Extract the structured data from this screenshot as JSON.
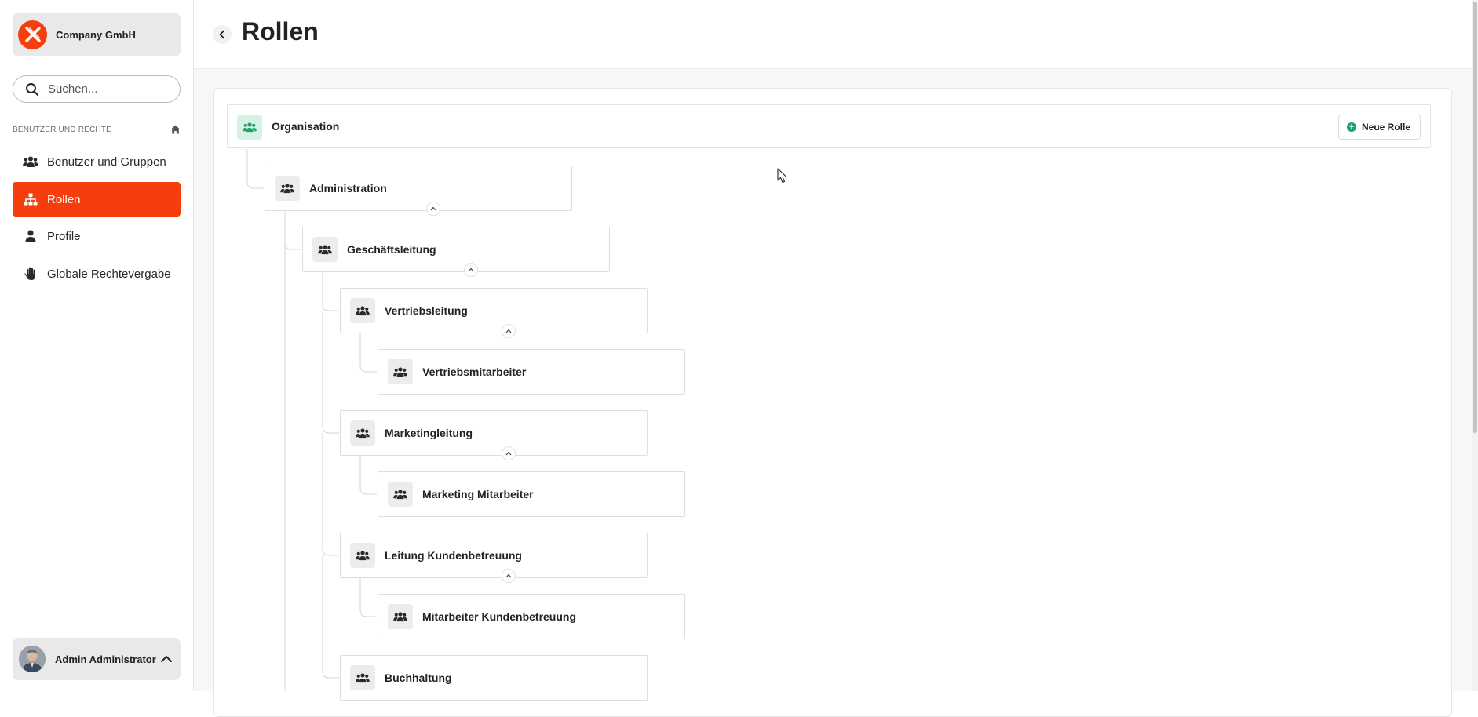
{
  "company": {
    "name": "Company GmbH"
  },
  "search": {
    "placeholder": "Suchen..."
  },
  "sidebar": {
    "section_label": "BENUTZER UND RECHTE",
    "items": [
      {
        "label": "Benutzer und Gruppen",
        "icon": "users-icon",
        "active": false
      },
      {
        "label": "Rollen",
        "icon": "sitemap-icon",
        "active": true
      },
      {
        "label": "Profile",
        "icon": "person-icon",
        "active": false
      },
      {
        "label": "Globale Rechtevergabe",
        "icon": "hand-icon",
        "active": false
      }
    ]
  },
  "user": {
    "name": "Admin Administrator"
  },
  "header": {
    "title": "Rollen"
  },
  "org": {
    "label": "Organisation",
    "new_role_label": "Neue Rolle"
  },
  "roles": [
    {
      "label": "Administration",
      "level": 0,
      "expanded": true
    },
    {
      "label": "Geschäftsleitung",
      "level": 1,
      "expanded": true
    },
    {
      "label": "Vertriebsleitung",
      "level": 2,
      "expanded": true
    },
    {
      "label": "Vertriebsmitarbeiter",
      "level": 3,
      "expanded": false
    },
    {
      "label": "Marketingleitung",
      "level": 2,
      "expanded": true
    },
    {
      "label": "Marketing Mitarbeiter",
      "level": 3,
      "expanded": false
    },
    {
      "label": "Leitung Kundenbetreuung",
      "level": 2,
      "expanded": true
    },
    {
      "label": "Mitarbeiter Kundenbetreuung",
      "level": 3,
      "expanded": false
    },
    {
      "label": "Buchhaltung",
      "level": 2,
      "expanded": false
    }
  ],
  "colors": {
    "accent": "#f53e0c",
    "org_icon_bg": "#d7f1e6",
    "new_role_icon": "#1aa36b"
  }
}
